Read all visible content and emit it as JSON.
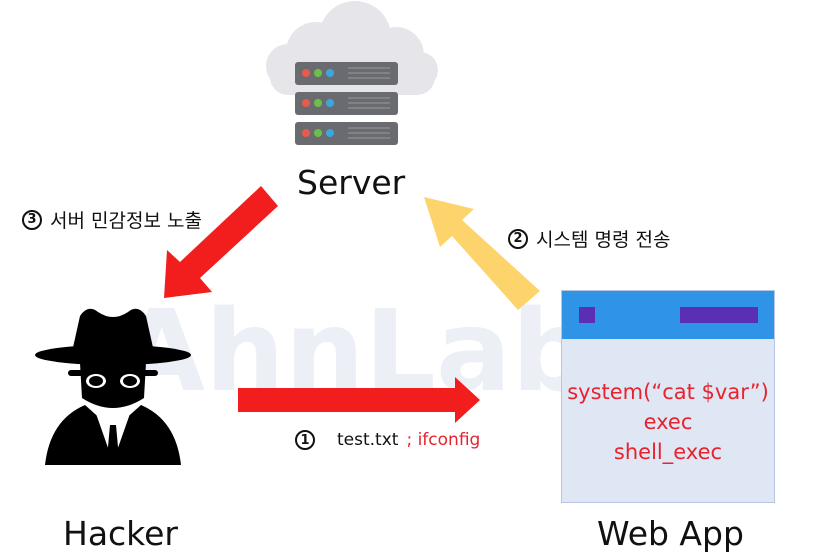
{
  "watermark": "AhnLab",
  "nodes": {
    "server": "Server",
    "hacker": "Hacker",
    "webapp": "Web App"
  },
  "steps": {
    "step1": {
      "num": "1",
      "text_a": "test.txt",
      "text_b": "; ifconfig"
    },
    "step2": {
      "num": "2",
      "text": "시스템 명령 전송"
    },
    "step3": {
      "num": "3",
      "text": "서버 민감정보 노출"
    }
  },
  "code_lines": [
    "system(“cat $var”)",
    "exec",
    "shell_exec"
  ],
  "colors": {
    "attack_arrow": "#f21d1d",
    "command_arrow": "#fdd36b",
    "webapp_bar": "#2f93e6",
    "webapp_accent": "#5b2fb2",
    "code_text": "#e8232d",
    "cloud": "#e6e6ea",
    "server_rack": "#6a6b70",
    "watermark": "#eceff5"
  },
  "icons": {
    "server": "server-cloud-icon",
    "hacker": "hacker-spy-icon"
  }
}
